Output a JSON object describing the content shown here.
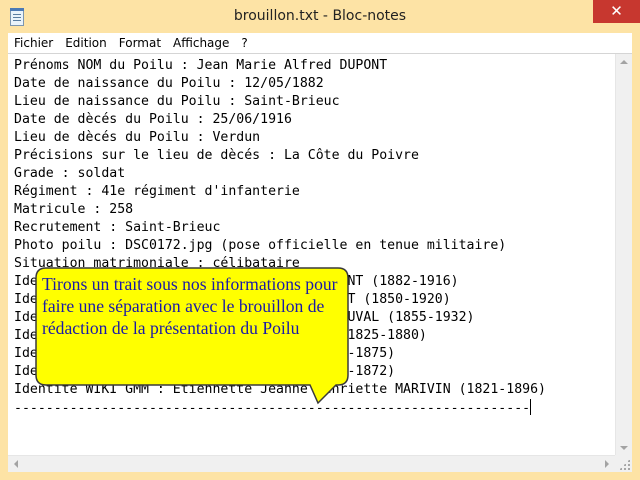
{
  "window": {
    "title": "brouillon.txt - Bloc-notes",
    "app_icon": "notepad-icon",
    "close_glyph": "✕",
    "colors": {
      "frame": "#fde3a5",
      "close": "#c7372f"
    }
  },
  "menu": {
    "items": [
      "Fichier",
      "Edition",
      "Format",
      "Affichage",
      "?"
    ]
  },
  "editor": {
    "lines": [
      "Prénoms NOM du Poilu : Jean Marie Alfred DUPONT",
      "Date de naissance du Poilu : 12/05/1882",
      "Lieu de naissance du Poilu : Saint-Brieuc",
      "Date de dècés du Poilu : 25/06/1916",
      "Lieu de dècés du Poilu : Verdun",
      "Précisions sur le lieu de dècés : La Côte du Poivre",
      "Grade : soldat",
      "Régiment : 41e régiment d'infanterie",
      "Matricule : 258",
      "Recrutement : Saint-Brieuc",
      "Photo poilu : DSC0172.jpg (pose officielle en tenue militaire)",
      "Situation matrimoniale : célibataire",
      "Identité WIKI GMM : Jean Marie Alfred DUPONT (1882-1916)",
      "Identité WIKI GMM : Jean Marie Louis DUPONT (1850-1920)",
      "Identité WIKI GMM : Marie Anne Françoise DUVAL (1855-1932)",
      "Identité WIKI GMM : Jacques Marie DUPONT (1825-1880)",
      "Identité WIKI GMM : Anne Marie CANAL (1826-1875)",
      "Identité WIKI GMM : Jean Louis DUVAL (1817-1872)",
      "Identité WIKI GMM : Etiennette Jeanne Henriette MARIVIN (1821-1896)",
      "-----------------------------------------------------------------"
    ]
  },
  "callout": {
    "text": "Tirons un trait sous nos informations pour faire une séparation avec le brouillon de rédaction de la présentation du Poilu",
    "colors": {
      "fill": "#ffff00",
      "border": "#3a3a3a",
      "text": "#1a1aa8"
    }
  }
}
